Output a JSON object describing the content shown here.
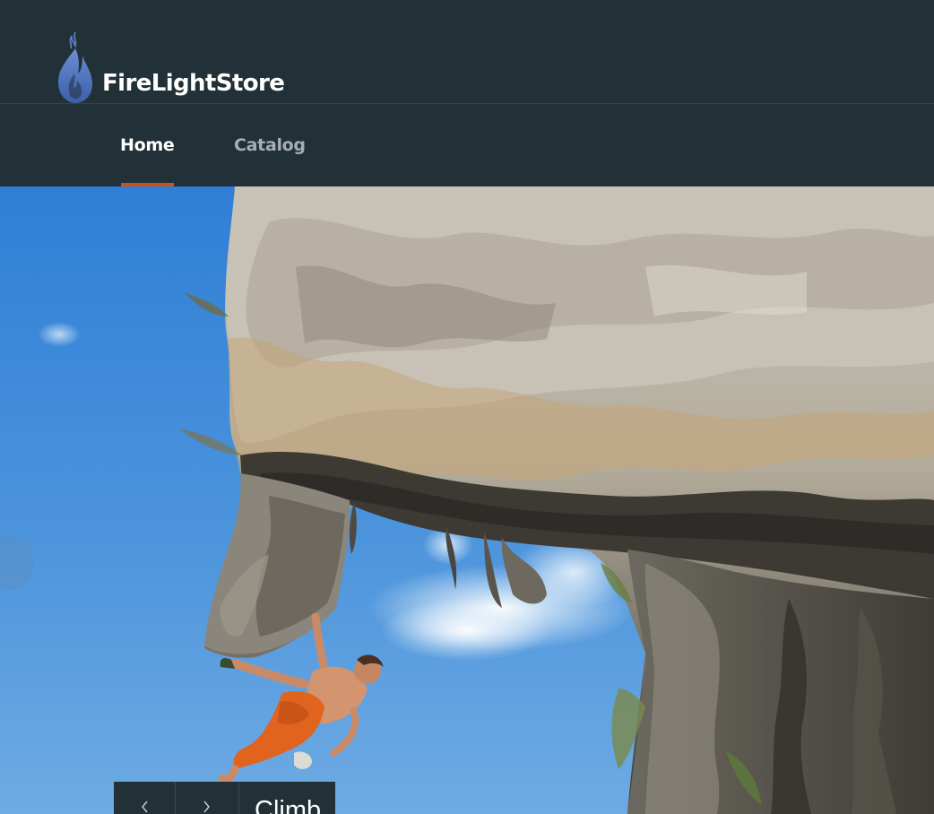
{
  "brand": {
    "name": "FireLightStore",
    "logo_icon": "flame-icon",
    "colors": {
      "header_bg": "#223037",
      "flame": "#4a72b8",
      "active_underline": "#c6521f"
    }
  },
  "nav": {
    "items": [
      {
        "label": "Home",
        "active": true
      },
      {
        "label": "Catalog",
        "active": false
      }
    ]
  },
  "hero": {
    "caption": "Climb",
    "prev_icon": "chevron-left-icon",
    "next_icon": "chevron-right-icon"
  }
}
